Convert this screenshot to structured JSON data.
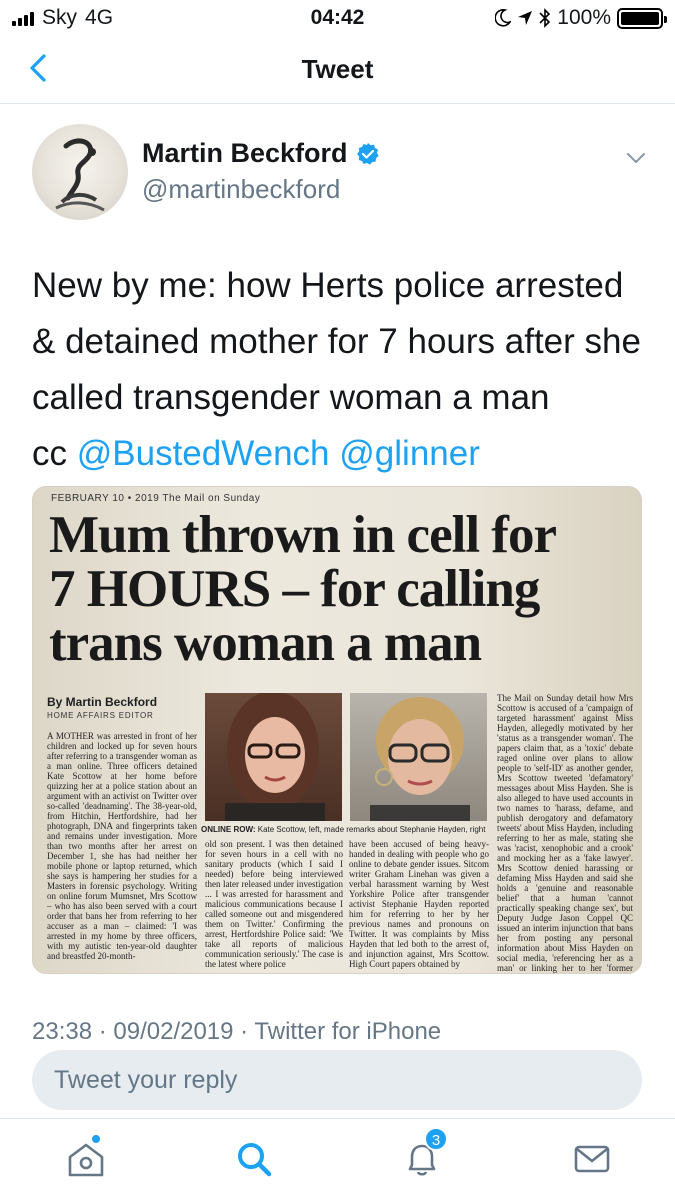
{
  "status_bar": {
    "carrier": "Sky",
    "network": "4G",
    "time": "04:42",
    "battery_percent": "100%",
    "battery_level": 1.0
  },
  "nav": {
    "title": "Tweet",
    "back_icon": "chevron-left-icon"
  },
  "author": {
    "name": "Martin Beckford",
    "handle": "@martinbeckford",
    "verified": true
  },
  "tweet": {
    "text": "New by me: how Herts police arrested & detained mother for 7 hours after she called transgender woman a man",
    "cc_prefix": "cc",
    "mentions": [
      "@BustedWench",
      "@glinner"
    ]
  },
  "newspaper": {
    "date_line": "FEBRUARY 10 • 2019 The Mail on Sunday",
    "headline_lines": [
      "Mum thrown in cell for",
      "7 HOURS – for calling",
      "trans woman a man"
    ],
    "byline": "By Martin Beckford",
    "byline_role": "HOME AFFAIRS EDITOR",
    "caption_label": "ONLINE ROW:",
    "caption_text": "Kate Scottow, left, made remarks about Stephanie Hayden, right",
    "col_a": "A MOTHER was arrested in front of her children and locked up for seven hours after referring to a transgender woman as a man online. Three officers detained Kate Scottow at her home before quizzing her at a police station about an argument with an activist on Twitter over so-called 'deadnaming'. The 38-year-old, from Hitchin, Hertfordshire, had her photograph, DNA and fingerprints taken and remains under investigation. More than two months after her arrest on December 1, she has had neither her mobile phone or laptop returned, which she says is hampering her studies for a Masters in forensic psychology. Writing on online forum Mumsnet, Mrs Scottow – who has also been served with a court order that bans her from referring to her accuser as a man – claimed: 'I was arrested in my home by three officers, with my autistic ten-year-old daughter and breastfed 20-month-",
    "col_b": "old son present. I was then detained for seven hours in a cell with no sanitary products (which I said I needed) before being interviewed then later released under investigation ... I was arrested for harassment and malicious communications because I called someone out and misgendered them on Twitter.' Confirming the arrest, Hertfordshire Police said: 'We take all reports of malicious communication seriously.' The case is the latest where police",
    "col_c": "have been accused of being heavy-handed in dealing with people who go online to debate gender issues. Sitcom writer Graham Linehan was given a verbal harassment warning by West Yorkshire Police after transgender activist Stephanie Hayden reported him for referring to her by her previous names and pronouns on Twitter. It was complaints by Miss Hayden that led both to the arrest of, and injunction against, Mrs Scottow. High Court papers obtained by",
    "col_d": "The Mail on Sunday detail how Mrs Scottow is accused of a 'campaign of targeted harassment' against Miss Hayden, allegedly motivated by her 'status as a transgender woman'. The papers claim that, as a 'toxic' debate raged online over plans to allow people to 'self-ID' as another gender, Mrs Scottow tweeted 'defamatory' messages about Miss Hayden. She is also alleged to have used accounts in two names to 'harass, defame, and publish derogatory and defamatory tweets' about Miss Hayden, including referring to her as male, stating she was 'racist, xenophobic and a crook' and mocking her as a 'fake lawyer'. Mrs Scottow denied harassing or defaming Miss Hayden and said she holds a 'genuine and reasonable belief' that a human 'cannot practically speaking change sex', but Deputy Judge Jason Coppel QC issued an interim injunction that bans her from posting any personal information about Miss Hayden on social media, 'referencing her as a man' or linking her to her 'former male identity'. Mrs Scottow last night declined to comment."
  },
  "footer": {
    "timestamp": "23:38 · 09/02/2019 · Twitter for iPhone"
  },
  "reply": {
    "placeholder": "Tweet your reply"
  },
  "tabs": [
    {
      "name": "home",
      "icon": "home-icon"
    },
    {
      "name": "search",
      "icon": "search-icon"
    },
    {
      "name": "notifications",
      "icon": "bell-icon",
      "badge": "3"
    },
    {
      "name": "messages",
      "icon": "mail-icon"
    }
  ],
  "colors": {
    "accent": "#1da1f2",
    "text": "#14171a",
    "secondary": "#657786",
    "reply_bg": "#e6ecf0"
  }
}
